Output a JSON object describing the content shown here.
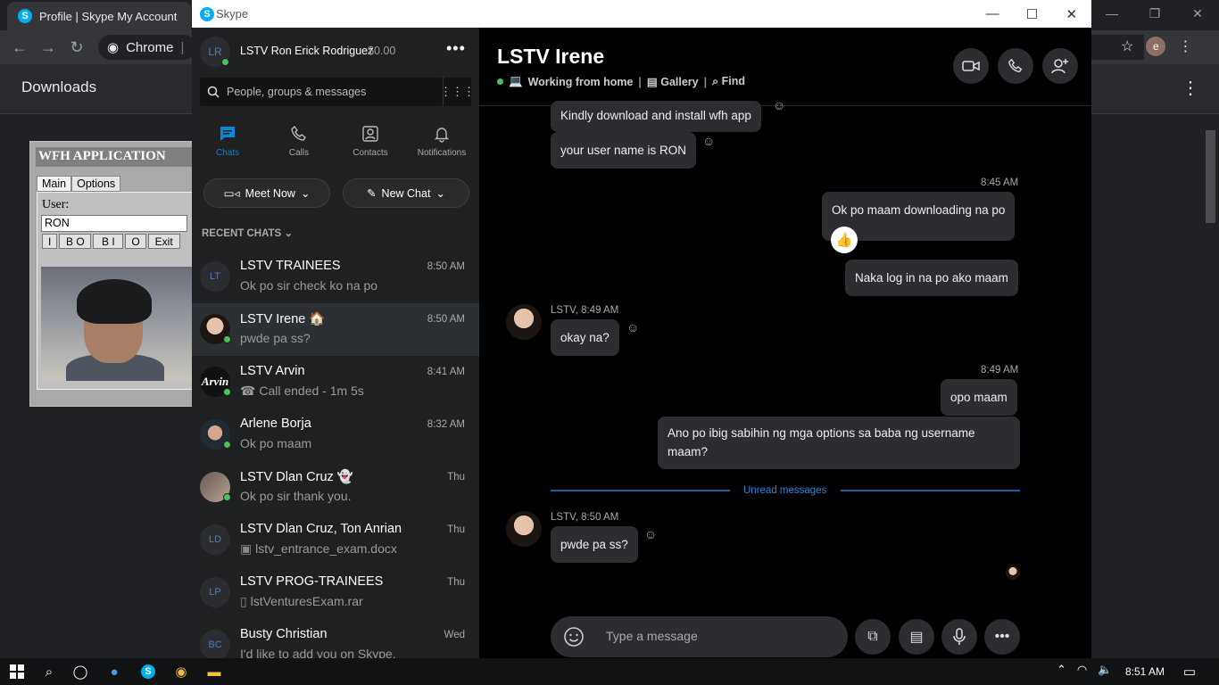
{
  "chrome": {
    "tab_title": "Profile | Skype My Account",
    "omnibox_text": "Chrome",
    "omnibox_separator": "|",
    "omnibox_tail": "c",
    "profile_initial": "e",
    "downloads_title": "Downloads"
  },
  "wfh_app": {
    "title": "WFH APPLICATION",
    "tabs": [
      "Main",
      "Options"
    ],
    "user_label": "User:",
    "user_value": "RON",
    "buttons": [
      "I",
      "B O",
      "B I",
      "O",
      "Exit"
    ]
  },
  "skype": {
    "window_title": "Skype",
    "profile": {
      "initials": "LR",
      "name": "LSTV Ron Erick Rodriguez",
      "credit": "$0.00"
    },
    "search_placeholder": "People, groups & messages",
    "nav": [
      "Chats",
      "Calls",
      "Contacts",
      "Notifications"
    ],
    "meet_now": "Meet Now",
    "new_chat": "New Chat",
    "recent_label": "RECENT CHATS",
    "chats": [
      {
        "initials": "LT",
        "name": "LSTV TRAINEES",
        "time": "8:50 AM",
        "preview": "Ok po sir check ko na po"
      },
      {
        "initials": "",
        "name": "LSTV Irene 🏠",
        "time": "8:50 AM",
        "preview": "pwde pa ss?"
      },
      {
        "initials": "Arvin",
        "name": "LSTV Arvin",
        "time": "8:41 AM",
        "preview": "Call ended - 1m 5s"
      },
      {
        "initials": "",
        "name": "Arlene Borja",
        "time": "8:32 AM",
        "preview": "Ok po maam"
      },
      {
        "initials": "",
        "name": "LSTV Dlan Cruz 👻",
        "time": "Thu",
        "preview": "Ok po sir thank you."
      },
      {
        "initials": "LD",
        "name": "LSTV Dlan Cruz, Ton Anrian",
        "time": "Thu",
        "preview": "lstv_entrance_exam.docx"
      },
      {
        "initials": "LP",
        "name": "LSTV PROG-TRAINEES",
        "time": "Thu",
        "preview": "lstVenturesExam.rar"
      },
      {
        "initials": "BC",
        "name": "Busty Christian",
        "time": "Wed",
        "preview": "I'd like to add you on Skype."
      }
    ],
    "conversation": {
      "title": "LSTV Irene",
      "status": "Working from home",
      "status_icon": "💻",
      "gallery": "Gallery",
      "find": "Find",
      "messages": {
        "m1": "Kindly download and install wfh app",
        "m2": "your user name is RON",
        "t_845": "8:45 AM",
        "m3": "Ok po maam downloading na po",
        "m4": "Naka log in na po ako maam",
        "meta_849": "LSTV, 8:49 AM",
        "m5": "okay na?",
        "t_849": "8:49 AM",
        "m6": "opo maam",
        "m7": "Ano po ibig sabihin ng mga options sa baba ng username maam?",
        "unread": "Unread messages",
        "meta_850": "LSTV, 8:50 AM",
        "m8": "pwde pa ss?"
      },
      "composer_placeholder": "Type a message"
    }
  },
  "taskbar": {
    "clock": "8:51 AM"
  },
  "colors": {
    "skype_blue": "#00aff0",
    "online": "#46c35b",
    "accent": "#0a86d8"
  }
}
